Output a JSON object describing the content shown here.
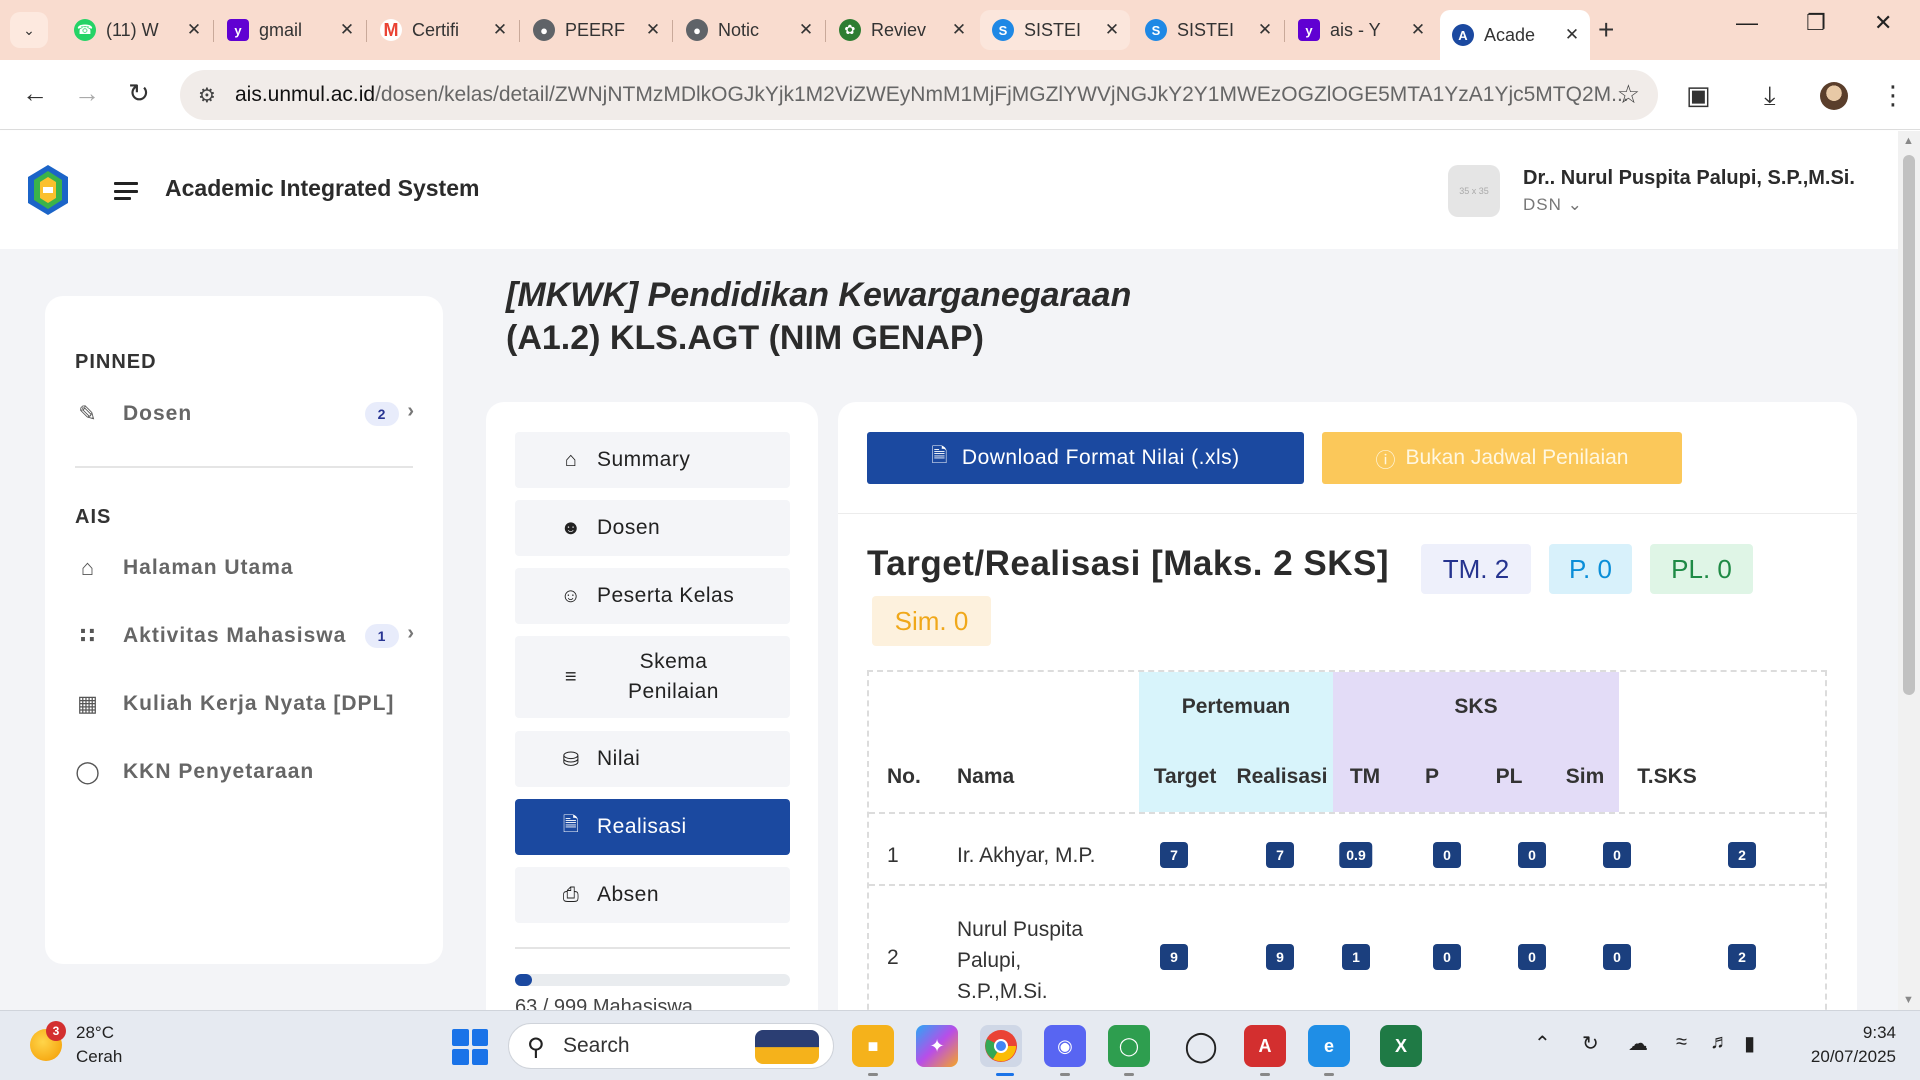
{
  "browser": {
    "tabs": [
      {
        "title": "(11) W",
        "favicon": "whatsapp-icon",
        "color": "#25d366"
      },
      {
        "title": "gmail",
        "favicon": "yahoo-icon",
        "color": "#6001d2"
      },
      {
        "title": "Certifi",
        "favicon": "gmail-icon",
        "color": "#ea4335"
      },
      {
        "title": "PEERF",
        "favicon": "globe-icon",
        "color": "#5f6368"
      },
      {
        "title": "Notic",
        "favicon": "globe-icon",
        "color": "#5f6368"
      },
      {
        "title": "Reviev",
        "favicon": "journal-icon",
        "color": "#2e7d32"
      },
      {
        "title": "SISTEI",
        "favicon": "sister-icon",
        "color": "#1e88e5"
      },
      {
        "title": "SISTEI",
        "favicon": "sister-icon",
        "color": "#1e88e5"
      },
      {
        "title": "ais - Y",
        "favicon": "yahoo-icon",
        "color": "#6001d2"
      },
      {
        "title": "Acade",
        "favicon": "ais-icon",
        "color": "#1b49a0"
      }
    ],
    "url_domain": "ais.unmul.ac.id",
    "url_path": "/dosen/kelas/detail/ZWNjNTMzMDlkOGJkYjk1M2ViZWEyNmM1MjFjMGZlYWVjNGJkY2Y1MWEzOGZlOGE5MTA1YzA1Yjc5MTQ2M..."
  },
  "header": {
    "app_title": "Academic Integrated System",
    "avatar_text": "35 x 35",
    "user_name": "Dr.. Nurul Puspita Palupi, S.P.,M.Si.",
    "user_role": "DSN"
  },
  "sidebar": {
    "pinned_label": "PINNED",
    "pinned": [
      {
        "label": "Dosen",
        "badge": "2"
      }
    ],
    "ais_label": "AIS",
    "items": [
      {
        "label": "Halaman Utama"
      },
      {
        "label": "Aktivitas Mahasiswa",
        "badge": "1"
      },
      {
        "label": "Kuliah Kerja Nyata [DPL]"
      },
      {
        "label": "KKN Penyetaraan"
      }
    ]
  },
  "page": {
    "title_line1": "[MKWK] Pendidikan Kewarganegaraan",
    "title_line2": "(A1.2) KLS.AGT (NIM GENAP)"
  },
  "menu": {
    "items": [
      {
        "label": "Summary"
      },
      {
        "label": "Dosen"
      },
      {
        "label": "Peserta Kelas"
      },
      {
        "label": "Skema Penilaian"
      },
      {
        "label": "Nilai"
      },
      {
        "label": "Realisasi"
      },
      {
        "label": "Absen"
      }
    ],
    "progress_fraction": 0.063,
    "progress_text": "63 / 999 Mahasiswa"
  },
  "content": {
    "download_button": "Download Format Nilai (.xls)",
    "jadwal_button": "Bukan Jadwal Penilaian",
    "target_title": "Target/Realisasi [Maks. 2 SKS]",
    "pills": {
      "tm": "TM. 2",
      "p": "P. 0",
      "pl": "PL. 0",
      "sim": "Sim. 0"
    },
    "table": {
      "group_pertemuan": "Pertemuan",
      "group_sks": "SKS",
      "headers": {
        "no": "No.",
        "nama": "Nama",
        "target": "Target",
        "realisasi": "Realisasi",
        "tm": "TM",
        "p": "P",
        "pl": "PL",
        "sim": "Sim",
        "tsks": "T.SKS"
      },
      "rows": [
        {
          "no": "1",
          "nama": "Ir. Akhyar, M.P.",
          "target": "7",
          "realisasi": "7",
          "tm": "0.9",
          "p": "0",
          "pl": "0",
          "sim": "0",
          "tsks": "2"
        },
        {
          "no": "2",
          "nama": "Nurul Puspita Palupi, S.P.,M.Si.",
          "target": "9",
          "realisasi": "9",
          "tm": "1",
          "p": "0",
          "pl": "0",
          "sim": "0",
          "tsks": "2"
        }
      ]
    }
  },
  "taskbar": {
    "weather_badge": "3",
    "temperature": "28°C",
    "weather": "Cerah",
    "search_placeholder": "Search",
    "time": "9:34",
    "date": "20/07/2025"
  }
}
